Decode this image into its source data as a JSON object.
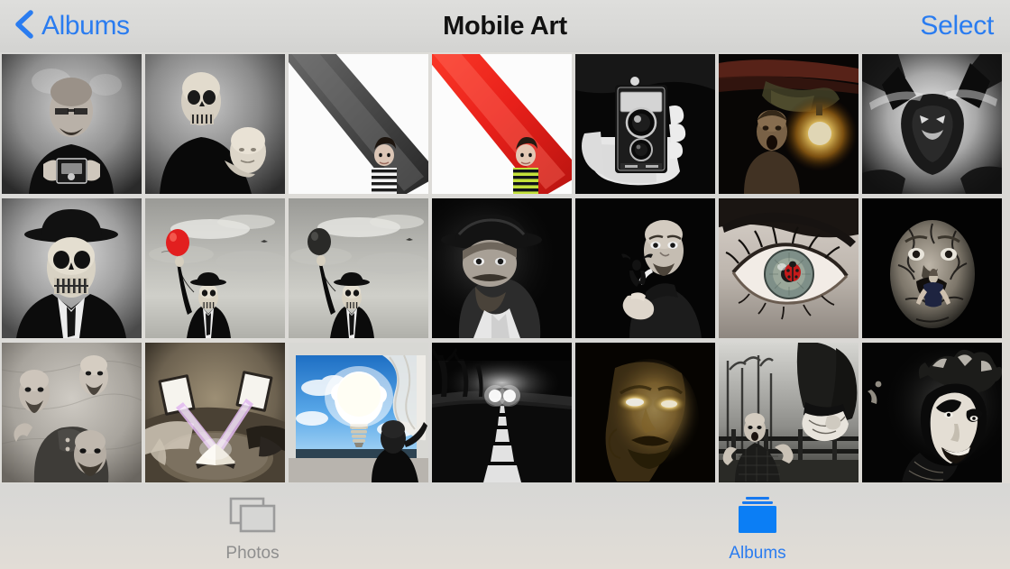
{
  "navbar": {
    "back_label": "Albums",
    "back_icon": "chevron-left-icon",
    "title": "Mobile Art",
    "select_label": "Select",
    "accent_color": "#2a7cf0"
  },
  "grid": {
    "columns": 7,
    "rows": 3,
    "photos": [
      {
        "id": 1,
        "alt": "Bald bearded man in black holding vintage twin-lens camera, black and white",
        "theme": "bw-portrait-camera"
      },
      {
        "id": 2,
        "alt": "Figure in black with skull face holding a white mannequin head, black and white",
        "theme": "bw-skull-mannequin"
      },
      {
        "id": 3,
        "alt": "Boy in striped shirt peeking from behind a grey diagonal stripe on white",
        "theme": "white-grey-stripe-boy"
      },
      {
        "id": 4,
        "alt": "Boy in green striped shirt peeking from behind a red diagonal stripe on white",
        "theme": "white-red-stripe-boy"
      },
      {
        "id": 5,
        "alt": "Hand holding a vintage twin-lens reflex camera, high contrast black and white",
        "theme": "bw-hand-camera"
      },
      {
        "id": 6,
        "alt": "Screaming man in a dark basement lit by a glowing bare bulb",
        "theme": "dark-bulb-scream"
      },
      {
        "id": 7,
        "alt": "Grainy black and white monster silhouette, high contrast",
        "theme": "bw-monster"
      },
      {
        "id": 8,
        "alt": "Skull-faced man in bowler hat, suit and tie, black and white",
        "theme": "bw-bowler-skull"
      },
      {
        "id": 9,
        "alt": "Man in bowler hat holding a red balloon under a cloudy sky",
        "theme": "sky-red-balloon"
      },
      {
        "id": 10,
        "alt": "Man in bowler hat holding a black balloon under a cloudy sky",
        "theme": "sky-black-balloon"
      },
      {
        "id": 11,
        "alt": "Bearded man in fedora hat half lit in darkness, black and white",
        "theme": "bw-fedora-portrait"
      },
      {
        "id": 12,
        "alt": "Bald man pointing a small figure held in his hand, black and white",
        "theme": "bw-pointing-man"
      },
      {
        "id": 13,
        "alt": "Macro close-up of an eye with a red ladybug on the iris",
        "theme": "eye-ladybug"
      },
      {
        "id": 14,
        "alt": "Cracked stone face with a tiny man climbing out of the mouth",
        "theme": "cracked-stone-face"
      },
      {
        "id": 15,
        "alt": "Man juggling three floating copies of his own head, black and white",
        "theme": "bw-floating-heads"
      },
      {
        "id": 16,
        "alt": "Open book on a table projecting purple light beams onto two panels",
        "theme": "book-light-beams"
      },
      {
        "id": 17,
        "alt": "Glowing light bulb cloud in a blue sky behind a curtain, man silhouetted",
        "theme": "bulb-cloud-sky"
      },
      {
        "id": 18,
        "alt": "Foggy night road with car headlights approaching, black and white",
        "theme": "foggy-road-lights"
      },
      {
        "id": 19,
        "alt": "Man's face in darkness with glowing white eyes",
        "theme": "glowing-eyes-face"
      },
      {
        "id": 20,
        "alt": "Man reacting to a giant foot stepping over a fence, black and white",
        "theme": "bw-giant-foot"
      },
      {
        "id": 21,
        "alt": "Venetian jester mask in darkness, black and white",
        "theme": "bw-jester-mask"
      }
    ]
  },
  "tabbar": {
    "tabs": [
      {
        "key": "photos",
        "label": "Photos",
        "icon": "photos-stack-icon",
        "active": false
      },
      {
        "key": "albums",
        "label": "Albums",
        "icon": "albums-folder-icon",
        "active": true
      }
    ]
  }
}
